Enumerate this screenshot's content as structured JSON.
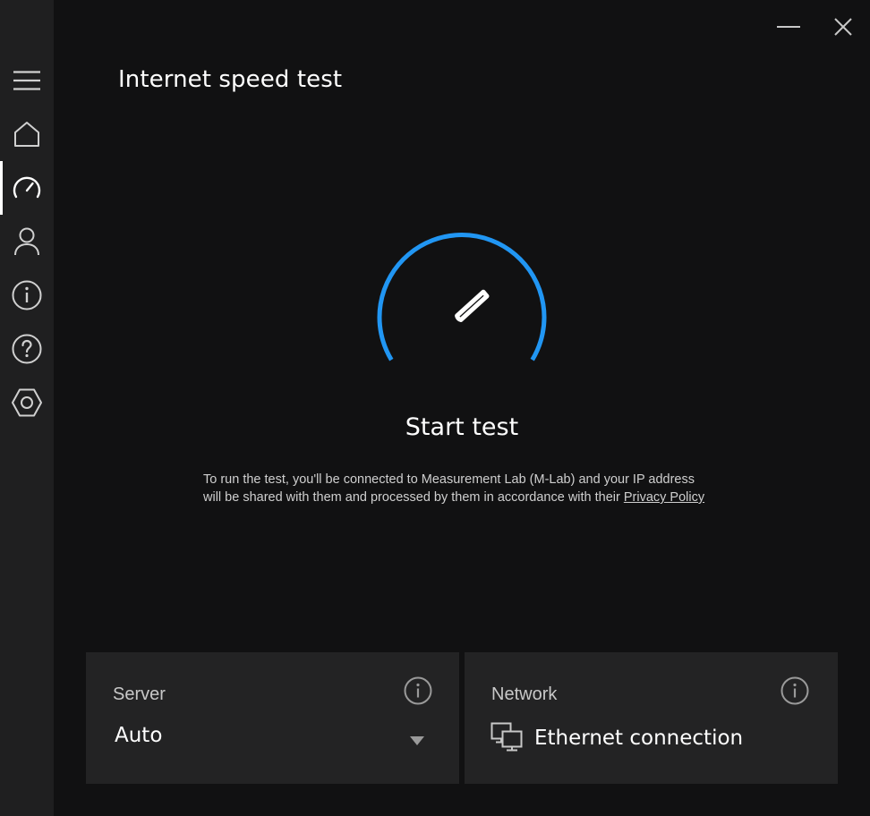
{
  "app": {
    "title": "Internet speed test",
    "accent_color": "#2196f3"
  },
  "sidebar": {
    "items": [
      {
        "name": "menu",
        "icon": "hamburger-menu-icon"
      },
      {
        "name": "home",
        "icon": "home-icon"
      },
      {
        "name": "speed-test",
        "icon": "speedometer-icon",
        "active": true
      },
      {
        "name": "account",
        "icon": "person-icon"
      },
      {
        "name": "about",
        "icon": "info-icon"
      },
      {
        "name": "help",
        "icon": "help-question-icon"
      },
      {
        "name": "settings",
        "icon": "settings-hexagon-icon"
      }
    ]
  },
  "window_controls": {
    "minimize_icon": "minimize-icon",
    "close_icon": "close-icon"
  },
  "main": {
    "start_button_label": "Start test",
    "disclaimer_line1": "To run the test, you'll be connected to Measurement Lab (M-Lab) and your IP address",
    "disclaimer_line2": "will be shared with them and processed by them in accordance with their",
    "privacy_link": "Privacy Policy"
  },
  "server_card": {
    "label": "Server",
    "value": "Auto"
  },
  "network_card": {
    "label": "Network",
    "value": "Ethernet connection"
  }
}
